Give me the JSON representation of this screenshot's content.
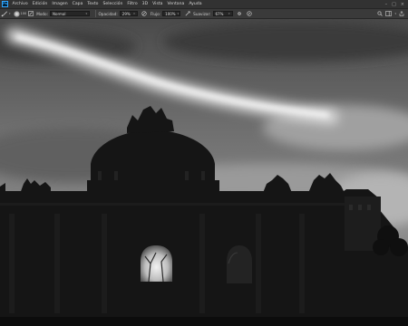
{
  "app": {
    "logo": "Ps",
    "menu": [
      "Archivo",
      "Edición",
      "Imagen",
      "Capa",
      "Texto",
      "Selección",
      "Filtro",
      "3D",
      "Vista",
      "Ventana",
      "Ayuda"
    ]
  },
  "options": {
    "brush_size": "100",
    "mode_label": "Modo:",
    "mode_value": "Normal",
    "opacity_label": "Opacidad:",
    "opacity_value": "29%",
    "flow_label": "Flujo:",
    "flow_value": "100%",
    "smoothing_label": "Suavizar:",
    "smoothing_value": "67%"
  },
  "icons": {
    "tool": "brush-icon",
    "brush_panel": "brush-panel-icon",
    "pressure_opacity": "pressure-opacity-icon",
    "airbrush": "airbrush-icon",
    "settings": "gear-icon",
    "pressure_size": "pressure-size-icon",
    "search": "search-icon",
    "workspace": "workspace-icon",
    "share": "share-icon"
  },
  "colors": {
    "menubar": "#323232",
    "optionsbar": "#3a3a3a",
    "field": "#262626",
    "accent": "#31a8ff"
  }
}
